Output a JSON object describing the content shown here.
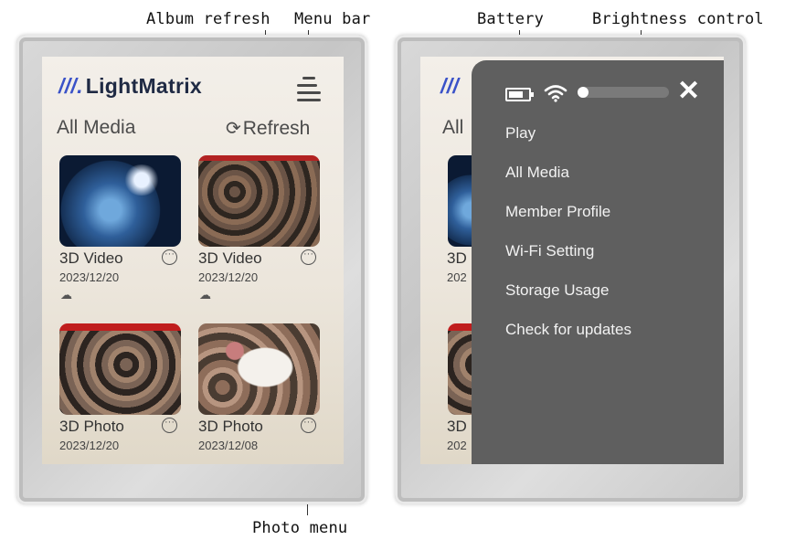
{
  "annotations": {
    "album_refresh": "Album refresh",
    "menu_bar": "Menu bar",
    "photo_menu": "Photo menu",
    "battery": "Battery",
    "brightness_control": "Brightness control"
  },
  "app": {
    "logo_mark": "///.",
    "logo_text": "LightMatrix",
    "section_title": "All Media",
    "refresh_icon": "refresh-icon",
    "refresh_label": "Refresh"
  },
  "media": [
    {
      "title": "3D Video",
      "date": "2023/12/20",
      "cloud": true,
      "thumb": "earth"
    },
    {
      "title": "3D Video",
      "date": "2023/12/20",
      "cloud": true,
      "thumb": "crowd"
    },
    {
      "title": "3D Photo",
      "date": "2023/12/20",
      "cloud": false,
      "thumb": "crowd2"
    },
    {
      "title": "3D Photo",
      "date": "2023/12/08",
      "cloud": false,
      "thumb": "cat"
    }
  ],
  "right_bg": {
    "logo_mark": "///",
    "section_fragment": "All",
    "title_fragment": "3D",
    "date_fragment": "202",
    "bottom_title_fragment": "3D",
    "bottom_date_fragment": "202"
  },
  "drawer": {
    "icons": [
      "battery-icon",
      "wifi-icon",
      "brightness-slider",
      "close-icon"
    ],
    "close_glyph": "✕",
    "items": [
      "Play",
      "All Media",
      "Member Profile",
      "Wi-Fi Setting",
      "Storage Usage",
      "Check for updates"
    ]
  },
  "colors": {
    "accent": "#3a52c8",
    "drawer_bg": "#5f5f5f",
    "screen_bg": "#ece6dc"
  }
}
